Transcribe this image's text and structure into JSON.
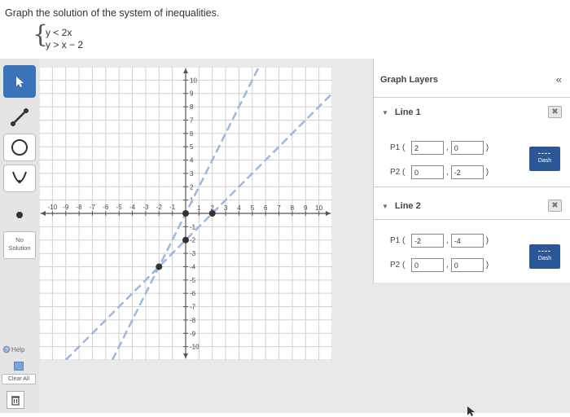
{
  "prompt": "Graph the solution of the system of inequalities.",
  "system": {
    "ineq1": "y < 2x",
    "ineq2": "y > x − 2"
  },
  "toolbar": {
    "tools": [
      "arrow-select",
      "line-segment",
      "circle",
      "parabola",
      "point"
    ],
    "no_solution": [
      "No",
      "Solution"
    ],
    "help": "Help",
    "clear_all": "Clear All",
    "delete_icon": "trash-icon"
  },
  "graph": {
    "xlim": [
      -11,
      11
    ],
    "ylim": [
      -11,
      11
    ],
    "x_ticks": [
      -10,
      -9,
      -8,
      -7,
      -6,
      -5,
      -4,
      -3,
      -2,
      -1,
      1,
      2,
      3,
      4,
      5,
      6,
      7,
      8,
      9,
      10
    ],
    "y_ticks": [
      10,
      9,
      8,
      7,
      6,
      5,
      4,
      3,
      2,
      1,
      -1,
      -2,
      -3,
      -4,
      -5,
      -6,
      -7,
      -8,
      -9,
      -10
    ],
    "line1": {
      "p1": [
        2,
        0
      ],
      "p2": [
        0,
        -2
      ],
      "style": "dash",
      "color": "#9db6e3"
    },
    "line2": {
      "p1": [
        -2,
        -4
      ],
      "p2": [
        0,
        0
      ],
      "style": "dash",
      "color": "#9db6e3"
    },
    "points": [
      [
        2,
        0
      ],
      [
        0,
        -2
      ],
      [
        -2,
        -4
      ],
      [
        0,
        0
      ]
    ],
    "point_color": "#333333"
  },
  "panel": {
    "title": "Graph Layers",
    "collapse": "«",
    "delete_glyph": "✖",
    "line1": {
      "label": "Line 1",
      "p1_label": "P1",
      "p1_x": "2",
      "p1_y": "0",
      "p2_label": "P2",
      "p2_x": "0",
      "p2_y": "-2",
      "style_label": "Dash",
      "style_glyph": "----"
    },
    "line2": {
      "label": "Line 2",
      "p1_label": "P1",
      "p1_x": "-2",
      "p1_y": "-4",
      "p2_label": "P2",
      "p2_x": "0",
      "p2_y": "0",
      "style_label": "Dash",
      "style_glyph": "----"
    }
  }
}
